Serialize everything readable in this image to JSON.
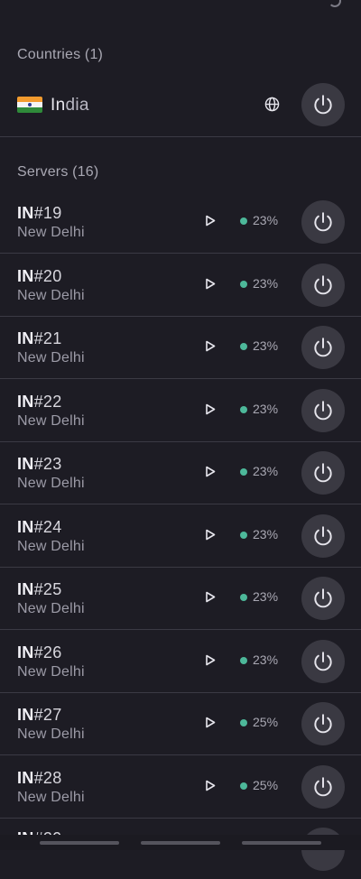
{
  "countries_section": {
    "title": "Countries (1)"
  },
  "country": {
    "name_first": "In",
    "name_rest": "dia"
  },
  "servers_section": {
    "title": "Servers (16)"
  },
  "servers": [
    {
      "prefix": "IN",
      "number": "#19",
      "city": "New Delhi",
      "load": "23%"
    },
    {
      "prefix": "IN",
      "number": "#20",
      "city": "New Delhi",
      "load": "23%"
    },
    {
      "prefix": "IN",
      "number": "#21",
      "city": "New Delhi",
      "load": "23%"
    },
    {
      "prefix": "IN",
      "number": "#22",
      "city": "New Delhi",
      "load": "23%"
    },
    {
      "prefix": "IN",
      "number": "#23",
      "city": "New Delhi",
      "load": "23%"
    },
    {
      "prefix": "IN",
      "number": "#24",
      "city": "New Delhi",
      "load": "23%"
    },
    {
      "prefix": "IN",
      "number": "#25",
      "city": "New Delhi",
      "load": "23%"
    },
    {
      "prefix": "IN",
      "number": "#26",
      "city": "New Delhi",
      "load": "23%"
    },
    {
      "prefix": "IN",
      "number": "#27",
      "city": "New Delhi",
      "load": "25%"
    },
    {
      "prefix": "IN",
      "number": "#28",
      "city": "New Delhi",
      "load": "25%"
    }
  ],
  "icons": {
    "country_flag": "india-flag-icon",
    "globe": "globe-icon",
    "power": "power-icon",
    "play": "play-icon",
    "load_status": "load-dot-icon"
  },
  "colors": {
    "background": "#1d1c24",
    "load_dot": "#4db89a",
    "power_button": "#3a3942"
  }
}
